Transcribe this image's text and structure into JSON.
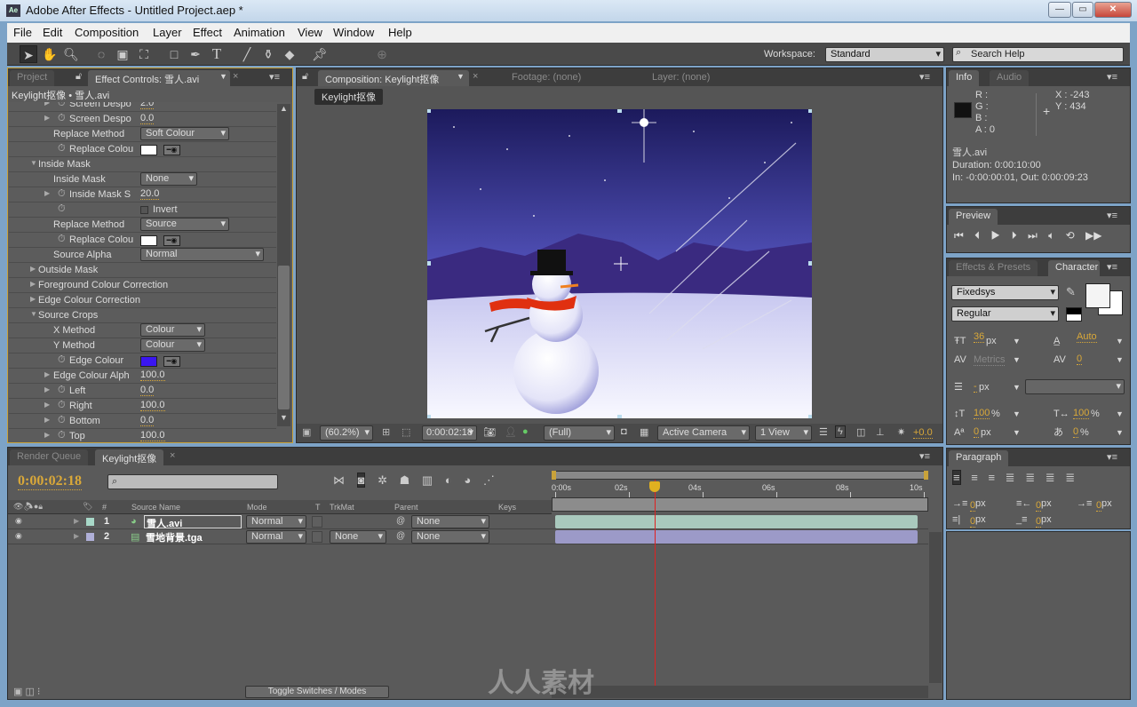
{
  "window": {
    "title": "Adobe After Effects - Untitled Project.aep *",
    "logo": "Ae"
  },
  "menu": [
    "File",
    "Edit",
    "Composition",
    "Layer",
    "Effect",
    "Animation",
    "View",
    "Window",
    "Help"
  ],
  "toolbar": {
    "workspace_label": "Workspace:",
    "workspace_value": "Standard",
    "search_placeholder": "Search Help"
  },
  "effect_panel": {
    "tabs": [
      "Project",
      "Effect Controls: 雪人.avi"
    ],
    "subheader": "Keylight抠像 • 雪人.avi",
    "rows": [
      {
        "label": "Screen Despo",
        "indent": 2,
        "twirl": "right",
        "stopwatch": true,
        "value": "2.0",
        "type": "num"
      },
      {
        "label": "Screen Despo",
        "indent": 2,
        "twirl": "right",
        "stopwatch": true,
        "value": "0.0",
        "type": "num"
      },
      {
        "label": "Replace Method",
        "indent": 2,
        "twirl": "none",
        "stopwatch": false,
        "value": "Soft Colour",
        "type": "dd"
      },
      {
        "label": "Replace Colou",
        "indent": 2,
        "twirl": "none",
        "stopwatch": true,
        "value": "#ffffff",
        "type": "color"
      },
      {
        "label": "Inside Mask",
        "indent": 1,
        "twirl": "down",
        "stopwatch": false,
        "type": "group"
      },
      {
        "label": "Inside Mask",
        "indent": 2,
        "twirl": "none",
        "stopwatch": false,
        "value": "None",
        "type": "dds"
      },
      {
        "label": "Inside Mask S",
        "indent": 2,
        "twirl": "right",
        "stopwatch": true,
        "value": "20.0",
        "type": "num"
      },
      {
        "label": "",
        "indent": 2,
        "twirl": "none",
        "stopwatch": true,
        "value": "Invert",
        "type": "check",
        "checked": false
      },
      {
        "label": "Replace Method",
        "indent": 2,
        "twirl": "none",
        "stopwatch": false,
        "value": "Source",
        "type": "dd"
      },
      {
        "label": "Replace Colou",
        "indent": 2,
        "twirl": "none",
        "stopwatch": true,
        "value": "#ffffff",
        "type": "color"
      },
      {
        "label": "Source Alpha",
        "indent": 2,
        "twirl": "none",
        "stopwatch": false,
        "value": "Normal",
        "type": "ddw"
      },
      {
        "label": "Outside Mask",
        "indent": 1,
        "twirl": "right",
        "stopwatch": false,
        "type": "group"
      },
      {
        "label": "Foreground Colour Correction",
        "indent": 1,
        "twirl": "right",
        "stopwatch": false,
        "type": "group"
      },
      {
        "label": "Edge Colour Correction",
        "indent": 1,
        "twirl": "right",
        "stopwatch": false,
        "type": "group"
      },
      {
        "label": "Source Crops",
        "indent": 1,
        "twirl": "down",
        "stopwatch": false,
        "type": "group"
      },
      {
        "label": "X Method",
        "indent": 2,
        "twirl": "none",
        "stopwatch": false,
        "value": "Colour",
        "type": "ddm"
      },
      {
        "label": "Y Method",
        "indent": 2,
        "twirl": "none",
        "stopwatch": false,
        "value": "Colour",
        "type": "ddm"
      },
      {
        "label": "Edge Colour",
        "indent": 2,
        "twirl": "none",
        "stopwatch": true,
        "value": "#3a16f0",
        "type": "color"
      },
      {
        "label": "Edge Colour Alph",
        "indent": 2,
        "twirl": "right",
        "stopwatch": false,
        "value": "100.0",
        "type": "num"
      },
      {
        "label": "Left",
        "indent": 2,
        "twirl": "right",
        "stopwatch": true,
        "value": "0.0",
        "type": "num"
      },
      {
        "label": "Right",
        "indent": 2,
        "twirl": "right",
        "stopwatch": true,
        "value": "100.0",
        "type": "num"
      },
      {
        "label": "Bottom",
        "indent": 2,
        "twirl": "right",
        "stopwatch": true,
        "value": "0.0",
        "type": "num"
      },
      {
        "label": "Top",
        "indent": 2,
        "twirl": "right",
        "stopwatch": true,
        "value": "100.0",
        "type": "num"
      }
    ]
  },
  "comp_panel": {
    "tabs": [
      "Composition: Keylight抠像",
      "Footage: (none)",
      "Layer: (none)"
    ],
    "comp_button": "Keylight抠像",
    "zoom": "(60.2%)",
    "timecode": "0:00:02:18",
    "resolution": "(Full)",
    "camera": "Active Camera",
    "views": "1 View",
    "exposure": "+0.0"
  },
  "info": {
    "tabs": [
      "Info",
      "Audio"
    ],
    "r": "R :",
    "g": "G :",
    "b": "B :",
    "a": "A : 0",
    "x": "X : -243",
    "y": "Y : 434",
    "name": "雪人.avi",
    "duration": "Duration: 0:00:10:00",
    "inout": "In: -0:00:00:01, Out: 0:00:09:23"
  },
  "preview": {
    "tab": "Preview"
  },
  "character": {
    "tabs": [
      "Effects & Presets",
      "Character"
    ],
    "font": "Fixedsys",
    "style": "Regular",
    "size": "36",
    "size_unit": "px",
    "leading": "Auto",
    "kerning": "Metrics",
    "tracking": "0",
    "stroke": "-",
    "stroke_unit": "px",
    "vscale": "100",
    "hscale": "100",
    "baseline": "0",
    "tsume": "0",
    "pct": "%"
  },
  "paragraph": {
    "tab": "Paragraph",
    "values": [
      "0",
      "0",
      "0",
      "0",
      "0"
    ],
    "unit": "px"
  },
  "timeline": {
    "tabs": [
      "Render Queue",
      "Keylight抠像"
    ],
    "timecode": "0:00:02:18",
    "columns": [
      "#",
      "Source Name",
      "Mode",
      "T",
      "TrkMat",
      "Parent",
      "Keys"
    ],
    "layers": [
      {
        "num": "1",
        "name": "雪人.avi",
        "mode": "Normal",
        "trkmat": "",
        "parent": "None",
        "color": "#a8d8c8",
        "bar": "#a9c9bd"
      },
      {
        "num": "2",
        "name": "雪地背景.tga",
        "mode": "Normal",
        "trkmat": "None",
        "parent": "None",
        "color": "#b0b0d8",
        "bar": "#9c9ac8"
      }
    ],
    "ruler": [
      "0:00s",
      "02s",
      "04s",
      "06s",
      "08s",
      "10s"
    ],
    "current_time_sec": 2.72,
    "duration_sec": 10,
    "toggle_label": "Toggle Switches / Modes"
  },
  "watermark": "人人素材"
}
